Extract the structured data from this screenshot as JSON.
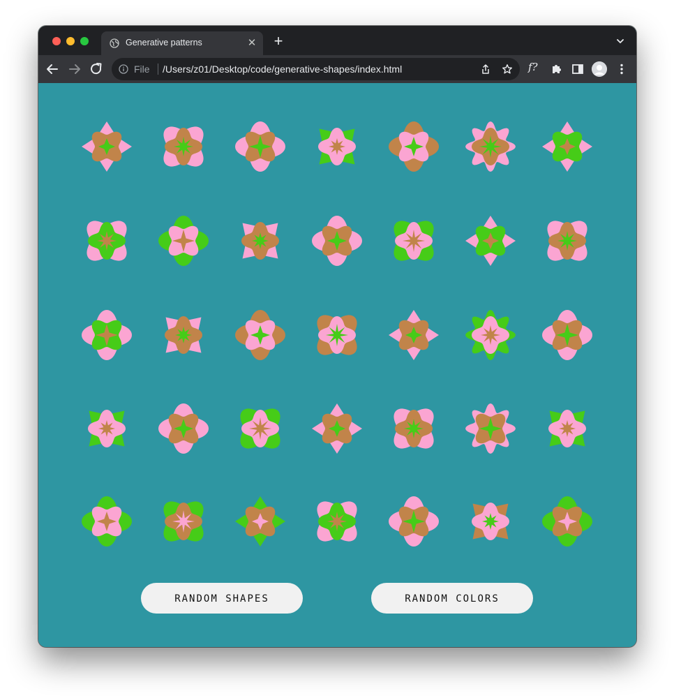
{
  "browser": {
    "tab_title": "Generative patterns",
    "tab_close": "✕",
    "new_tab": "+",
    "file_label": "File",
    "url": "/Users/z01/Desktop/code/generative-shapes/index.html",
    "extension_label": "f?"
  },
  "palette": {
    "background": "#2e96a2",
    "pink": "#fba5d2",
    "brown": "#c1844a",
    "green": "#46cc18"
  },
  "grid": {
    "columns": 7,
    "rows": 5,
    "cells": [
      [
        "pink",
        "brown",
        "green"
      ],
      [
        "pink",
        "brown",
        "green"
      ],
      [
        "pink",
        "brown",
        "green"
      ],
      [
        "green",
        "pink",
        "brown"
      ],
      [
        "brown",
        "pink",
        "green"
      ],
      [
        "pink",
        "brown",
        "green"
      ],
      [
        "pink",
        "green",
        "brown"
      ],
      [
        "pink",
        "green",
        "brown"
      ],
      [
        "green",
        "pink",
        "brown"
      ],
      [
        "pink",
        "brown",
        "green"
      ],
      [
        "pink",
        "brown",
        "green"
      ],
      [
        "green",
        "pink",
        "brown"
      ],
      [
        "pink",
        "green",
        "brown"
      ],
      [
        "pink",
        "brown",
        "green"
      ],
      [
        "pink",
        "green",
        "brown"
      ],
      [
        "pink",
        "brown",
        "green"
      ],
      [
        "brown",
        "pink",
        "green"
      ],
      [
        "brown",
        "pink",
        "green"
      ],
      [
        "pink",
        "brown",
        "green"
      ],
      [
        "green",
        "pink",
        "brown"
      ],
      [
        "pink",
        "brown",
        "green"
      ],
      [
        "green",
        "pink",
        "brown"
      ],
      [
        "pink",
        "brown",
        "green"
      ],
      [
        "green",
        "pink",
        "brown"
      ],
      [
        "pink",
        "brown",
        "green"
      ],
      [
        "pink",
        "brown",
        "green"
      ],
      [
        "pink",
        "brown",
        "green"
      ],
      [
        "green",
        "pink",
        "brown"
      ],
      [
        "green",
        "pink",
        "brown"
      ],
      [
        "green",
        "brown",
        "pink"
      ],
      [
        "green",
        "brown",
        "pink"
      ],
      [
        "pink",
        "green",
        "brown"
      ],
      [
        "pink",
        "brown",
        "green"
      ],
      [
        "brown",
        "pink",
        "green"
      ],
      [
        "green",
        "brown",
        "pink"
      ]
    ]
  },
  "buttons": {
    "random_shapes": "RANDOM SHAPES",
    "random_colors": "RANDOM COLORS"
  }
}
